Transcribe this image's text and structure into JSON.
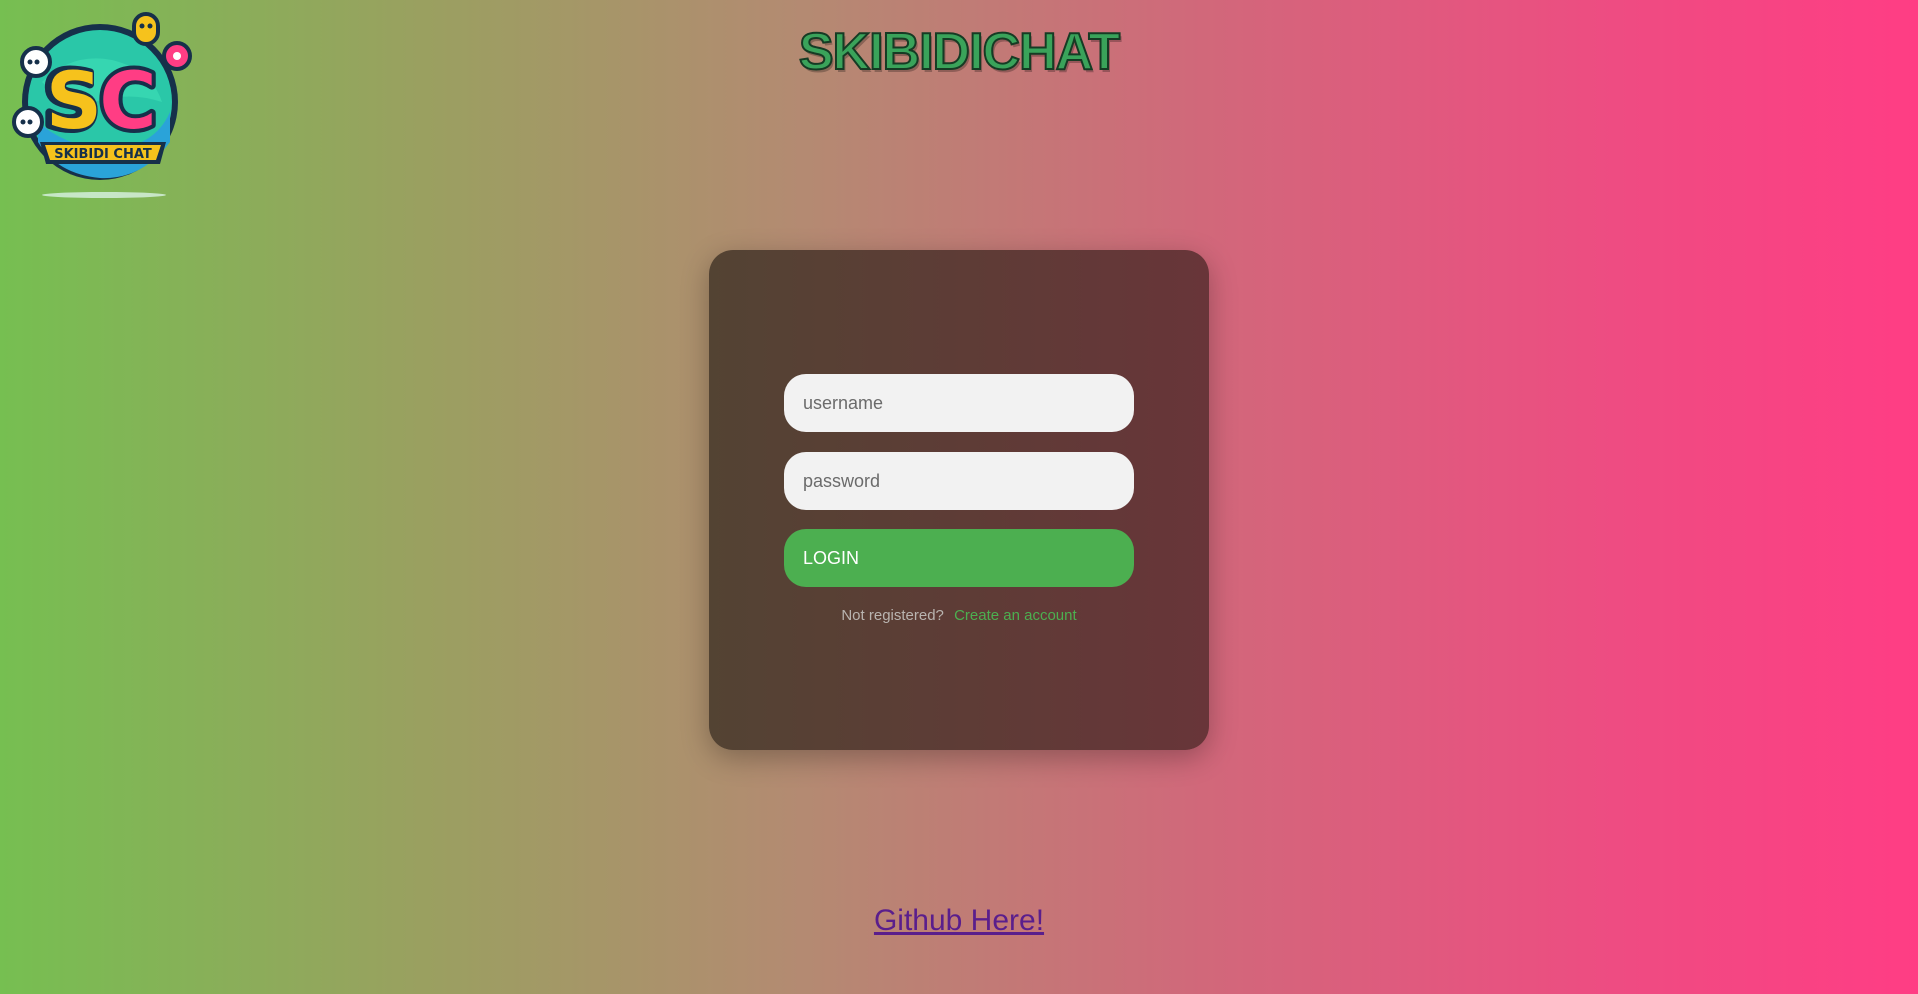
{
  "header": {
    "title": "SKIBIDICHAT",
    "logo_text": "SKIBIDI CHAT",
    "logo_letters": "SC"
  },
  "login_form": {
    "username_placeholder": "username",
    "password_placeholder": "password",
    "login_label": "LOGIN",
    "not_registered_text": "Not registered?",
    "create_account_label": "Create an account"
  },
  "footer": {
    "github_label": "Github Here!"
  },
  "colors": {
    "background_gradient_left": "#76bf51",
    "background_gradient_right": "#ff3d84",
    "card_background": "#5d3c36",
    "accent_green": "#4caf50",
    "link_purple": "#5a1e8c"
  },
  "icons": {
    "logo": "skibidi-chat-logo-icon"
  }
}
